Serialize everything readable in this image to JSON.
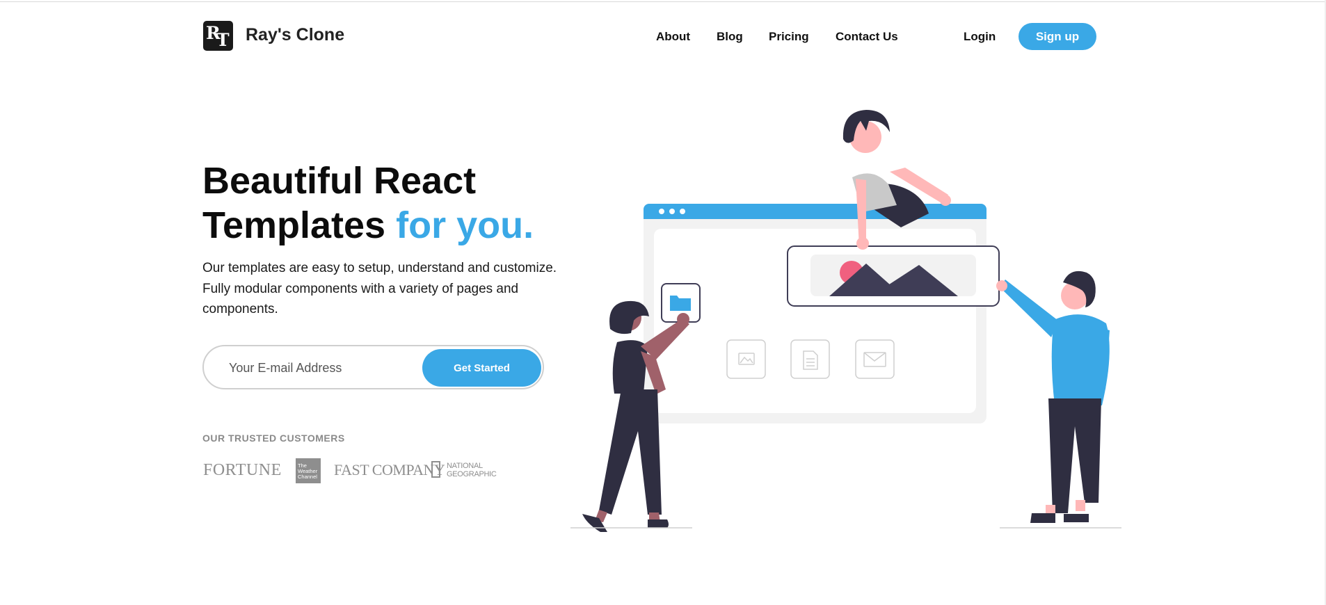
{
  "brand": {
    "name": "Ray's Clone",
    "logo_letters": [
      "R",
      "T"
    ]
  },
  "nav": {
    "links": [
      "About",
      "Blog",
      "Pricing",
      "Contact Us"
    ],
    "login": "Login",
    "signup": "Sign up"
  },
  "hero": {
    "title_line1": "Beautiful React",
    "title_line2_main": "Templates ",
    "title_line2_accent": "for you.",
    "description_lines": [
      "Our templates are easy to setup, understand and customize.",
      "Fully modular components with a variety of pages and",
      "components."
    ],
    "email_placeholder": "Your E-mail Address",
    "cta_label": "Get Started"
  },
  "customers": {
    "heading": "OUR TRUSTED CUSTOMERS",
    "logos": {
      "fortune": "FORTUNE",
      "weather": [
        "The",
        "Weather",
        "Channel"
      ],
      "fastcompany": "FAST COMPANY",
      "natgeo": [
        "NATIONAL",
        "GEOGRAPHIC"
      ]
    }
  },
  "colors": {
    "accent": "#3aa8e6",
    "dark": "#2f2e41",
    "skin": "#ffb8b8",
    "pink": "#f0607f"
  }
}
